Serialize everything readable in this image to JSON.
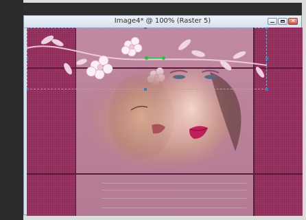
{
  "window": {
    "title": "Image4* @ 100% (Raster 5)"
  },
  "colors": {
    "panel_pattern": "#9c3464",
    "panel_center": "#c08aa2",
    "divider": "#5c1a38",
    "selection": "#7fb2d6",
    "node": "#2bbd3a"
  },
  "icons": [
    "minimize-icon",
    "maximize-icon",
    "close-icon",
    "flower-icon"
  ]
}
